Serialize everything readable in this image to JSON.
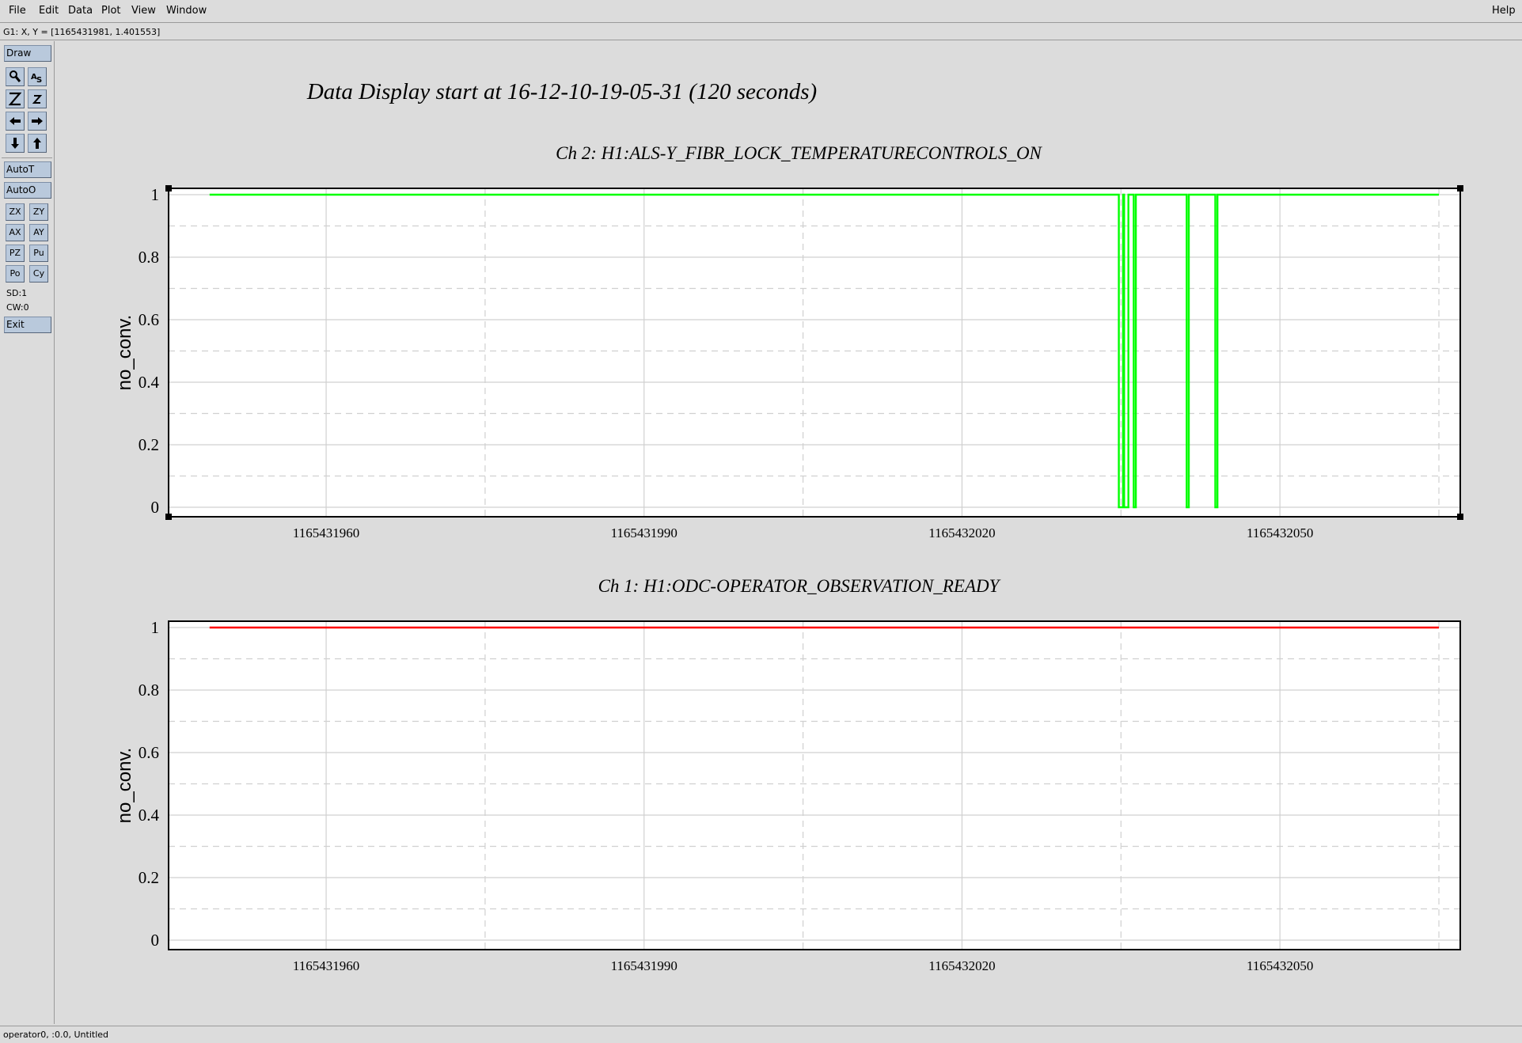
{
  "menu": {
    "file": "File",
    "edit": "Edit",
    "data": "Data",
    "plot": "Plot",
    "view": "View",
    "window": "Window",
    "help": "Help"
  },
  "coord_readout": "G1: X, Y = [1165431981, 1.401553]",
  "toolbar": {
    "draw": "Draw",
    "icons": [
      "magnify-icon",
      "as-icon",
      "zoom-in-z-icon",
      "zoom-out-z-icon",
      "arrow-left-icon",
      "arrow-right-icon",
      "arrow-down-icon",
      "arrow-up-icon"
    ],
    "autot": "AutoT",
    "autoo": "AutoO",
    "zx": "ZX",
    "zy": "ZY",
    "ax": "AX",
    "ay": "AY",
    "pz": "PZ",
    "pu": "Pu",
    "po": "Po",
    "cy": "Cy",
    "sd": "SD:1",
    "cw": "CW:0",
    "exit": "Exit"
  },
  "status": "operator0, :0.0, Untitled",
  "figure_title": "Data Display start at 16-12-10-19-05-31 (120 seconds)",
  "chart_data": [
    {
      "type": "line",
      "title": "Ch 2: H1:ALS-Y_FIBR_LOCK_TEMPERATURECONTROLS_ON",
      "ylabel": "no_conv.",
      "xlabel": "",
      "xlim": [
        1165431947,
        1165432065
      ],
      "ylim": [
        0,
        1
      ],
      "xticks": [
        1165431960,
        1165431990,
        1165432020,
        1165432050
      ],
      "xtick_labels": [
        "1165431960",
        "1165431990",
        "1165432020",
        "1165432050"
      ],
      "yticks": [
        0,
        0.2,
        0.4,
        0.6,
        0.8,
        1
      ],
      "ytick_labels": [
        "0",
        "0.2",
        "0.4",
        "0.6",
        "0.8",
        "1"
      ],
      "grid": true,
      "color": "#00ff00",
      "x": [
        1165431949,
        1165432034.8,
        1165432034.8,
        1165432035.2,
        1165432035.2,
        1165432035.3,
        1165432035.3,
        1165432035.7,
        1165432035.7,
        1165432036.2,
        1165432036.2,
        1165432036.4,
        1165432036.4,
        1165432041.2,
        1165432041.2,
        1165432041.4,
        1165432041.4,
        1165432043.9,
        1165432043.9,
        1165432044.1,
        1165432044.1,
        1165432065
      ],
      "y": [
        1,
        1,
        0,
        0,
        1,
        1,
        0,
        0,
        1,
        1,
        0,
        0,
        1,
        1,
        0,
        0,
        1,
        1,
        0,
        0,
        1,
        1
      ]
    },
    {
      "type": "line",
      "title": "Ch 1: H1:ODC-OPERATOR_OBSERVATION_READY",
      "ylabel": "no_conv.",
      "xlabel": "",
      "xlim": [
        1165431947,
        1165432065
      ],
      "ylim": [
        0,
        1
      ],
      "xticks": [
        1165431960,
        1165431990,
        1165432020,
        1165432050
      ],
      "xtick_labels": [
        "1165431960",
        "1165431990",
        "1165432020",
        "1165432050"
      ],
      "yticks": [
        0,
        0.2,
        0.4,
        0.6,
        0.8,
        1
      ],
      "ytick_labels": [
        "0",
        "0.2",
        "0.4",
        "0.6",
        "0.8",
        "1"
      ],
      "grid": true,
      "color": "#ff0000",
      "x": [
        1165431949,
        1165432065
      ],
      "y": [
        1,
        1
      ]
    }
  ]
}
